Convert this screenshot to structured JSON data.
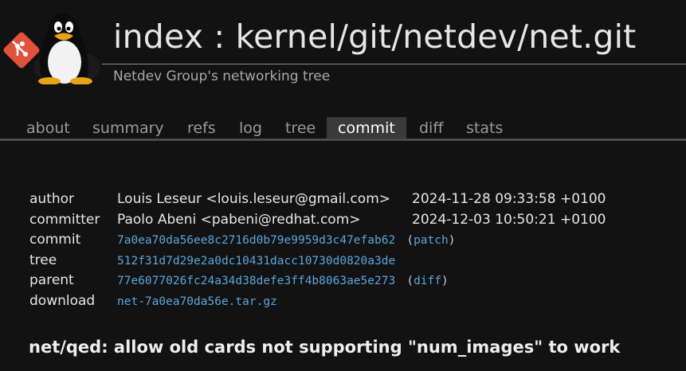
{
  "header": {
    "title": "index : kernel/git/netdev/net.git",
    "subtitle": "Netdev Group's networking tree"
  },
  "tabs": [
    {
      "label": "about"
    },
    {
      "label": "summary"
    },
    {
      "label": "refs"
    },
    {
      "label": "log"
    },
    {
      "label": "tree"
    },
    {
      "label": "commit",
      "active": true
    },
    {
      "label": "diff"
    },
    {
      "label": "stats"
    }
  ],
  "commit_info": {
    "author": {
      "label": "author",
      "value": "Louis Leseur <louis.leseur@gmail.com>",
      "date": "2024-11-28 09:33:58 +0100"
    },
    "committer": {
      "label": "committer",
      "value": "Paolo Abeni <pabeni@redhat.com>",
      "date": "2024-12-03 10:50:21 +0100"
    },
    "commit": {
      "label": "commit",
      "hash": "7a0ea70da56ee8c2716d0b79e9959d3c47efab62",
      "link_label": "patch"
    },
    "tree": {
      "label": "tree",
      "hash": "512f31d7d29e2a0dc10431dacc10730d0820a3de"
    },
    "parent": {
      "label": "parent",
      "hash": "77e6077026fc24a34d38defe3ff4b8063ae5e273",
      "link_label": "diff"
    },
    "download": {
      "label": "download",
      "file": "net-7a0ea70da56e.tar.gz"
    }
  },
  "subject": "net/qed: allow old cards not supporting \"num_images\" to work",
  "colors": {
    "background": "#121212",
    "link": "#5aa6dc",
    "git_logo": "#e2513a",
    "active_tab": "#3a3a3a"
  },
  "icons": {
    "git_logo": "git-logo-icon",
    "tux": "tux-penguin-icon"
  }
}
